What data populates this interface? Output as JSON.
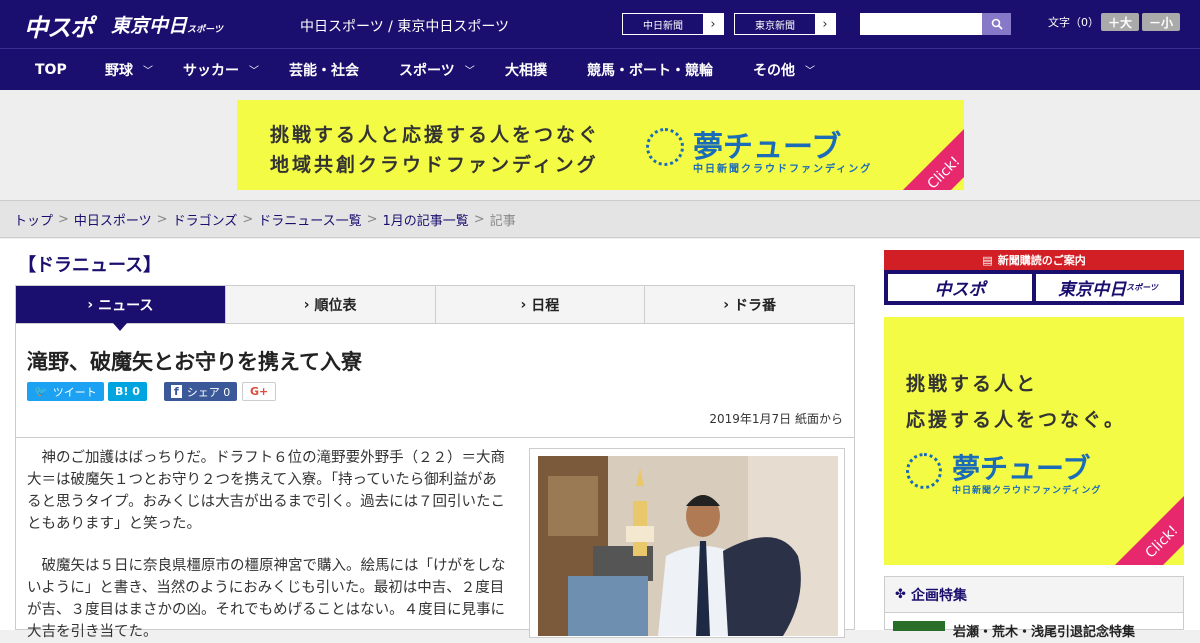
{
  "header": {
    "logo": "中スポ",
    "logo2": "東京中日",
    "logo2_small": "スポーツ",
    "site_name": "中日スポーツ / 東京中日スポーツ",
    "paper_links": [
      {
        "label": "中日新聞"
      },
      {
        "label": "東京新聞"
      }
    ],
    "search_placeholder": "",
    "font_size_label": "文字（0）",
    "font_larger": "＋大",
    "font_smaller": "－小"
  },
  "nav": [
    {
      "label": "TOP",
      "dropdown": false
    },
    {
      "label": "野球",
      "dropdown": true
    },
    {
      "label": "サッカー",
      "dropdown": true
    },
    {
      "label": "芸能・社会",
      "dropdown": false
    },
    {
      "label": "スポーツ",
      "dropdown": true
    },
    {
      "label": "大相撲",
      "dropdown": false
    },
    {
      "label": "競馬・ボート・競輪",
      "dropdown": false
    },
    {
      "label": "その他",
      "dropdown": true
    }
  ],
  "ad_banner": {
    "line1": "挑戦する人と応援する人をつなぐ",
    "line2": "地域共創クラウドファンディング",
    "brand": "夢チューブ",
    "brand_sub": "中日新聞クラウドファンディング",
    "click": "Click!"
  },
  "breadcrumb": {
    "items": [
      "トップ",
      "中日スポーツ",
      "ドラゴンズ",
      "ドラニュース一覧",
      "1月の記事一覧"
    ],
    "separator": ">",
    "current": "記事"
  },
  "section_title": "【ドラニュース】",
  "tabs": [
    {
      "label": "ニュース",
      "active": true
    },
    {
      "label": "順位表",
      "active": false
    },
    {
      "label": "日程",
      "active": false
    },
    {
      "label": "ドラ番",
      "active": false
    }
  ],
  "article": {
    "title": "滝野、破魔矢とお守りを携えて入寮",
    "share": {
      "tweet": "ツイート",
      "hatena": "B! 0",
      "facebook": "シェア 0",
      "gplus": "G+"
    },
    "date": "2019年1月7日 紙面から",
    "paragraphs": [
      "神のご加護はばっちりだ。ドラフト６位の滝野要外野手（２２）＝大商大＝は破魔矢１つとお守り２つを携えて入寮。「持っていたら御利益があると思うタイプ。おみくじは大吉が出るまで引く。過去には７回引いたこともあります」と笑った。",
      "破魔矢は５日に奈良県橿原市の橿原神宮で購入。絵馬には「けがをしないように」と書き、当然のようにおみくじも引いた。最初は中吉、２度目が吉、３度目はまさかの凶。それでもめげることはない。４度目に見事に大吉を引き当てた。"
    ]
  },
  "sidebar": {
    "subscribe_header": "新聞購読のご案内",
    "subscribe_buttons": [
      "中スポ",
      "東京中日"
    ],
    "subscribe_small": "スポーツ",
    "ad": {
      "line1": "挑戦する人と",
      "line2": "応援する人をつなぐ。",
      "brand": "夢チューブ",
      "brand_sub": "中日新聞クラウドファンディング",
      "click": "Click!"
    },
    "feature_title": "企画特集",
    "feature_item": "岩瀬・荒木・浅尾引退記念特集"
  },
  "colors": {
    "brand_navy": "#1a0f6e",
    "ad_yellow": "#f3fb44",
    "ad_blue": "#1a6bb8",
    "click_pink": "#e8286c",
    "twitter": "#1da1f2",
    "hatena": "#00a4de",
    "facebook": "#3b5998",
    "subscribe_red": "#d21f26"
  }
}
